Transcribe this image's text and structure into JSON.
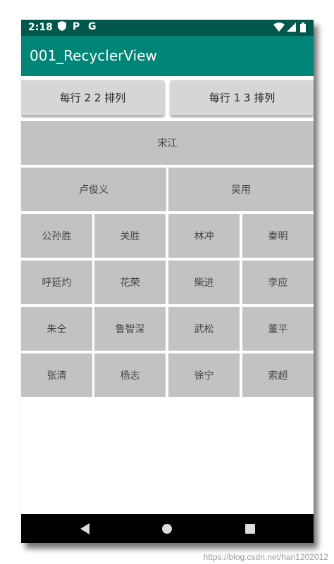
{
  "status_bar": {
    "time": "2:18",
    "icons": [
      "shield-icon",
      "parking-p-icon",
      "google-g-icon",
      "wifi-icon",
      "signal-icon",
      "battery-icon"
    ]
  },
  "app_bar": {
    "title": "001_RecyclerView"
  },
  "buttons": {
    "left": "每行 2 2 排列",
    "right": "每行 1 3 排列"
  },
  "grid": {
    "rows": [
      [
        "宋江"
      ],
      [
        "卢俊义",
        "吴用"
      ],
      [
        "公孙胜",
        "关胜",
        "林冲",
        "秦明"
      ],
      [
        "呼延灼",
        "花荣",
        "柴进",
        "李应"
      ],
      [
        "朱仝",
        "鲁智深",
        "武松",
        "董平"
      ],
      [
        "张清",
        "杨志",
        "徐宁",
        "索超"
      ]
    ]
  },
  "watermark": "https://blog.csdn.net/han1202012",
  "colors": {
    "status_bar": "#00574b",
    "app_bar": "#008577",
    "cell": "#c2c2c2",
    "button": "#d6d6d6"
  }
}
